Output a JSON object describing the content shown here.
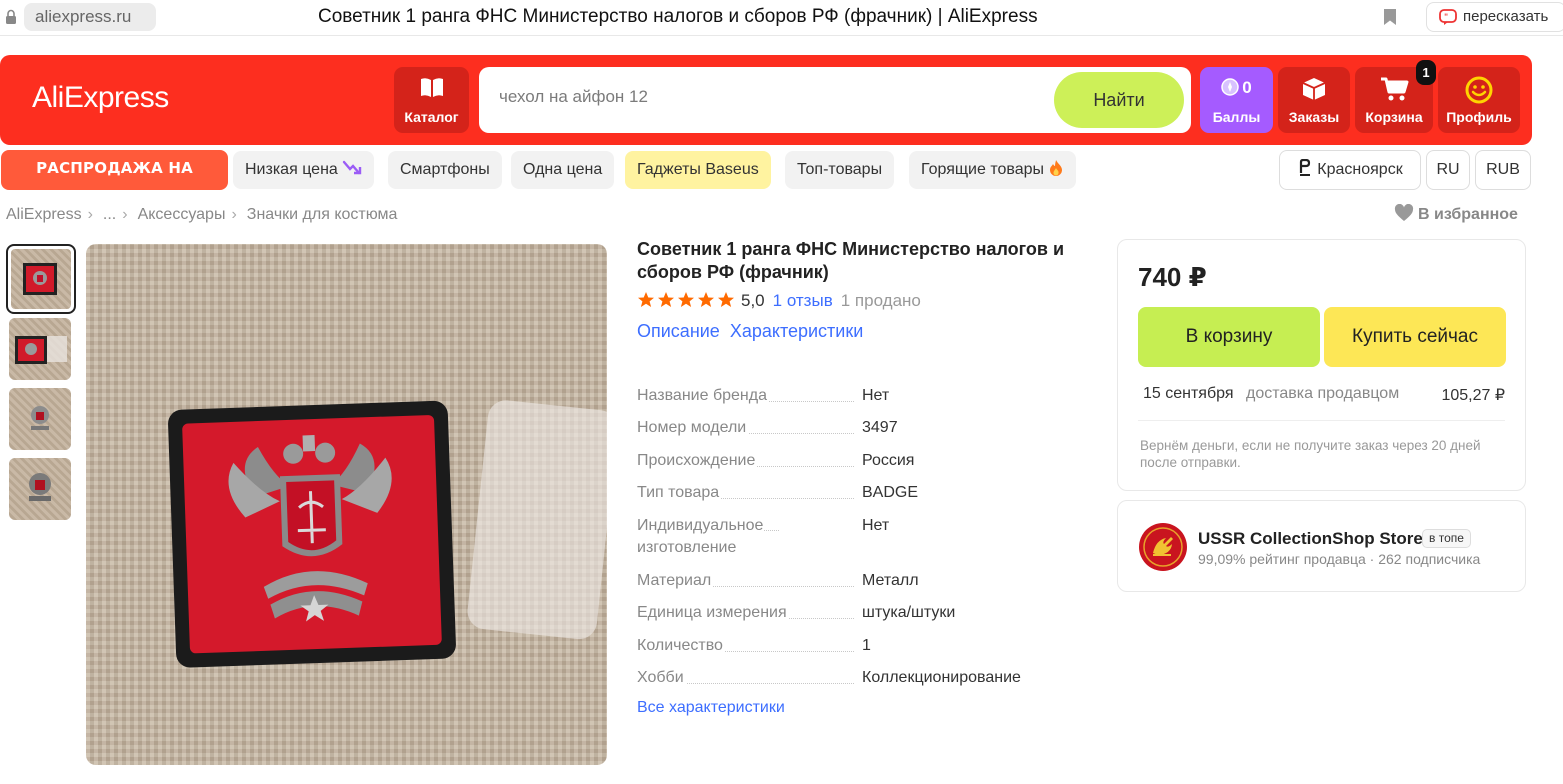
{
  "browser": {
    "url": "aliexpress.ru",
    "title": "Советник 1 ранга ФНС Министерство налогов и сборов РФ (фрачник) | AliExpress",
    "retell_label": "пересказать"
  },
  "header": {
    "logo": "AliExpress",
    "catalog_label": "Каталог",
    "search_placeholder": "чехол на айфон 12",
    "search_button": "Найти",
    "points_value": "0",
    "points_label": "Баллы",
    "orders_label": "Заказы",
    "cart_label": "Корзина",
    "cart_count": "1",
    "profile_label": "Профиль",
    "colors": {
      "brand_red": "#fd2e1f",
      "points_purple": "#a55bff",
      "search_green": "#cdf058"
    }
  },
  "promo": {
    "sale_label": "РАСПРОДАЖА НА МИЛЛИОН",
    "chips": [
      "Низкая цена",
      "Смартфоны",
      "Одна цена",
      "Гаджеты Baseus",
      "Топ-товары",
      "Горящие товары"
    ],
    "location": "Красноярск",
    "language": "RU",
    "currency": "RUB"
  },
  "breadcrumb": {
    "items": [
      "AliExpress",
      "...",
      "Аксессуары",
      "Значки для костюма"
    ],
    "favorite_label": "В избранное"
  },
  "product": {
    "title": "Советник 1 ранга ФНС Министерство налогов и сборов РФ (фрачник)",
    "rating": "5,0",
    "stars": 5,
    "reviews": "1 отзыв",
    "sold": "1 продано",
    "tabs": [
      "Описание",
      "Характеристики"
    ],
    "specs": [
      {
        "key": "Название бренда",
        "value": "Нет"
      },
      {
        "key": "Номер модели",
        "value": "3497"
      },
      {
        "key": "Происхождение",
        "value": "Россия"
      },
      {
        "key": "Тип товара",
        "value": "BADGE"
      },
      {
        "key": "Индивидуальное изготовление",
        "value": "Нет"
      },
      {
        "key": "Материал",
        "value": "Металл"
      },
      {
        "key": "Единица измерения",
        "value": "штука/штуки"
      },
      {
        "key": "Количество",
        "value": "1"
      },
      {
        "key": "Хобби",
        "value": "Коллекционирование"
      }
    ],
    "all_specs_label": "Все характеристики"
  },
  "buy": {
    "price": "740 ₽",
    "add_to_cart": "В корзину",
    "buy_now": "Купить сейчас",
    "delivery_date": "15 сентября",
    "delivery_type": "доставка продавцом",
    "delivery_price": "105,27 ₽",
    "guarantee": "Вернём деньги, если не получите заказ через 20 дней после отправки."
  },
  "store": {
    "name": "USSR CollectionShop Store",
    "badge": "в топе",
    "rating": "99,09% рейтинг продавца",
    "subscribers": "262 подписчика"
  }
}
